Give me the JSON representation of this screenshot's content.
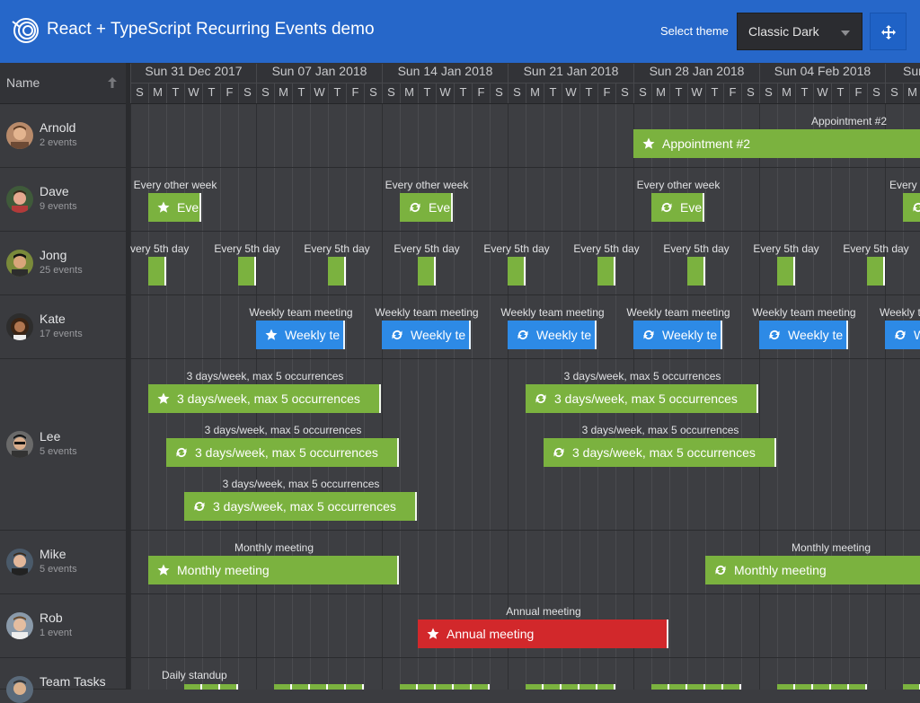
{
  "header": {
    "title": "React + TypeScript Recurring Events demo",
    "theme_label": "Select theme",
    "theme_value": "Classic Dark",
    "logo_icon": "bryntum-logo-icon",
    "move_icon": "move-arrows-icon"
  },
  "colors": {
    "header": "#2667c9",
    "green": "#7bb23f",
    "blue": "#2d8ae6",
    "red": "#d2282b",
    "background": "#3b3c40"
  },
  "name_column": {
    "label": "Name",
    "sort_icon": "arrow-up-icon"
  },
  "weeks": [
    "Sun 31 Dec 2017",
    "Sun 07 Jan 2018",
    "Sun 14 Jan 2018",
    "Sun 21 Jan 2018",
    "Sun 28 Jan 2018",
    "Sun 04 Feb 2018",
    "Sun"
  ],
  "days": [
    "S",
    "M",
    "T",
    "W",
    "T",
    "F",
    "S"
  ],
  "resources": [
    {
      "name": "Arnold",
      "count": "2 events"
    },
    {
      "name": "Dave",
      "count": "9 events"
    },
    {
      "name": "Jong",
      "count": "25 events"
    },
    {
      "name": "Kate",
      "count": "17 events"
    },
    {
      "name": "Lee",
      "count": "5 events"
    },
    {
      "name": "Mike",
      "count": "5 events"
    },
    {
      "name": "Rob",
      "count": "1 event"
    },
    {
      "name": "Team Tasks",
      "count": ""
    }
  ],
  "events": {
    "appointment": {
      "label": "Appointment #2",
      "bar": "Appointment #2",
      "icon": "star-icon"
    },
    "every_other_week": {
      "label": "Every other week",
      "bar": "Eve",
      "label_cut": "Every o"
    },
    "every_5th_day": {
      "label": "Every 5th day",
      "label_cut": "very 5th day"
    },
    "weekly_team": {
      "label": "Weekly team meeting",
      "bar": "Weekly te",
      "label_cut": "Weekly t",
      "bar_cut": "W"
    },
    "three_days": {
      "label": "3 days/week, max 5 occurrences",
      "bar": "3 days/week, max 5 occurrences"
    },
    "monthly": {
      "label": "Monthly meeting",
      "bar": "Monthly meeting"
    },
    "annual": {
      "label": "Annual meeting",
      "bar": "Annual meeting"
    },
    "standup": {
      "label": "Daily standup"
    },
    "recurring_icon": "recurring-arrows-icon",
    "star_icon": "star-icon"
  }
}
